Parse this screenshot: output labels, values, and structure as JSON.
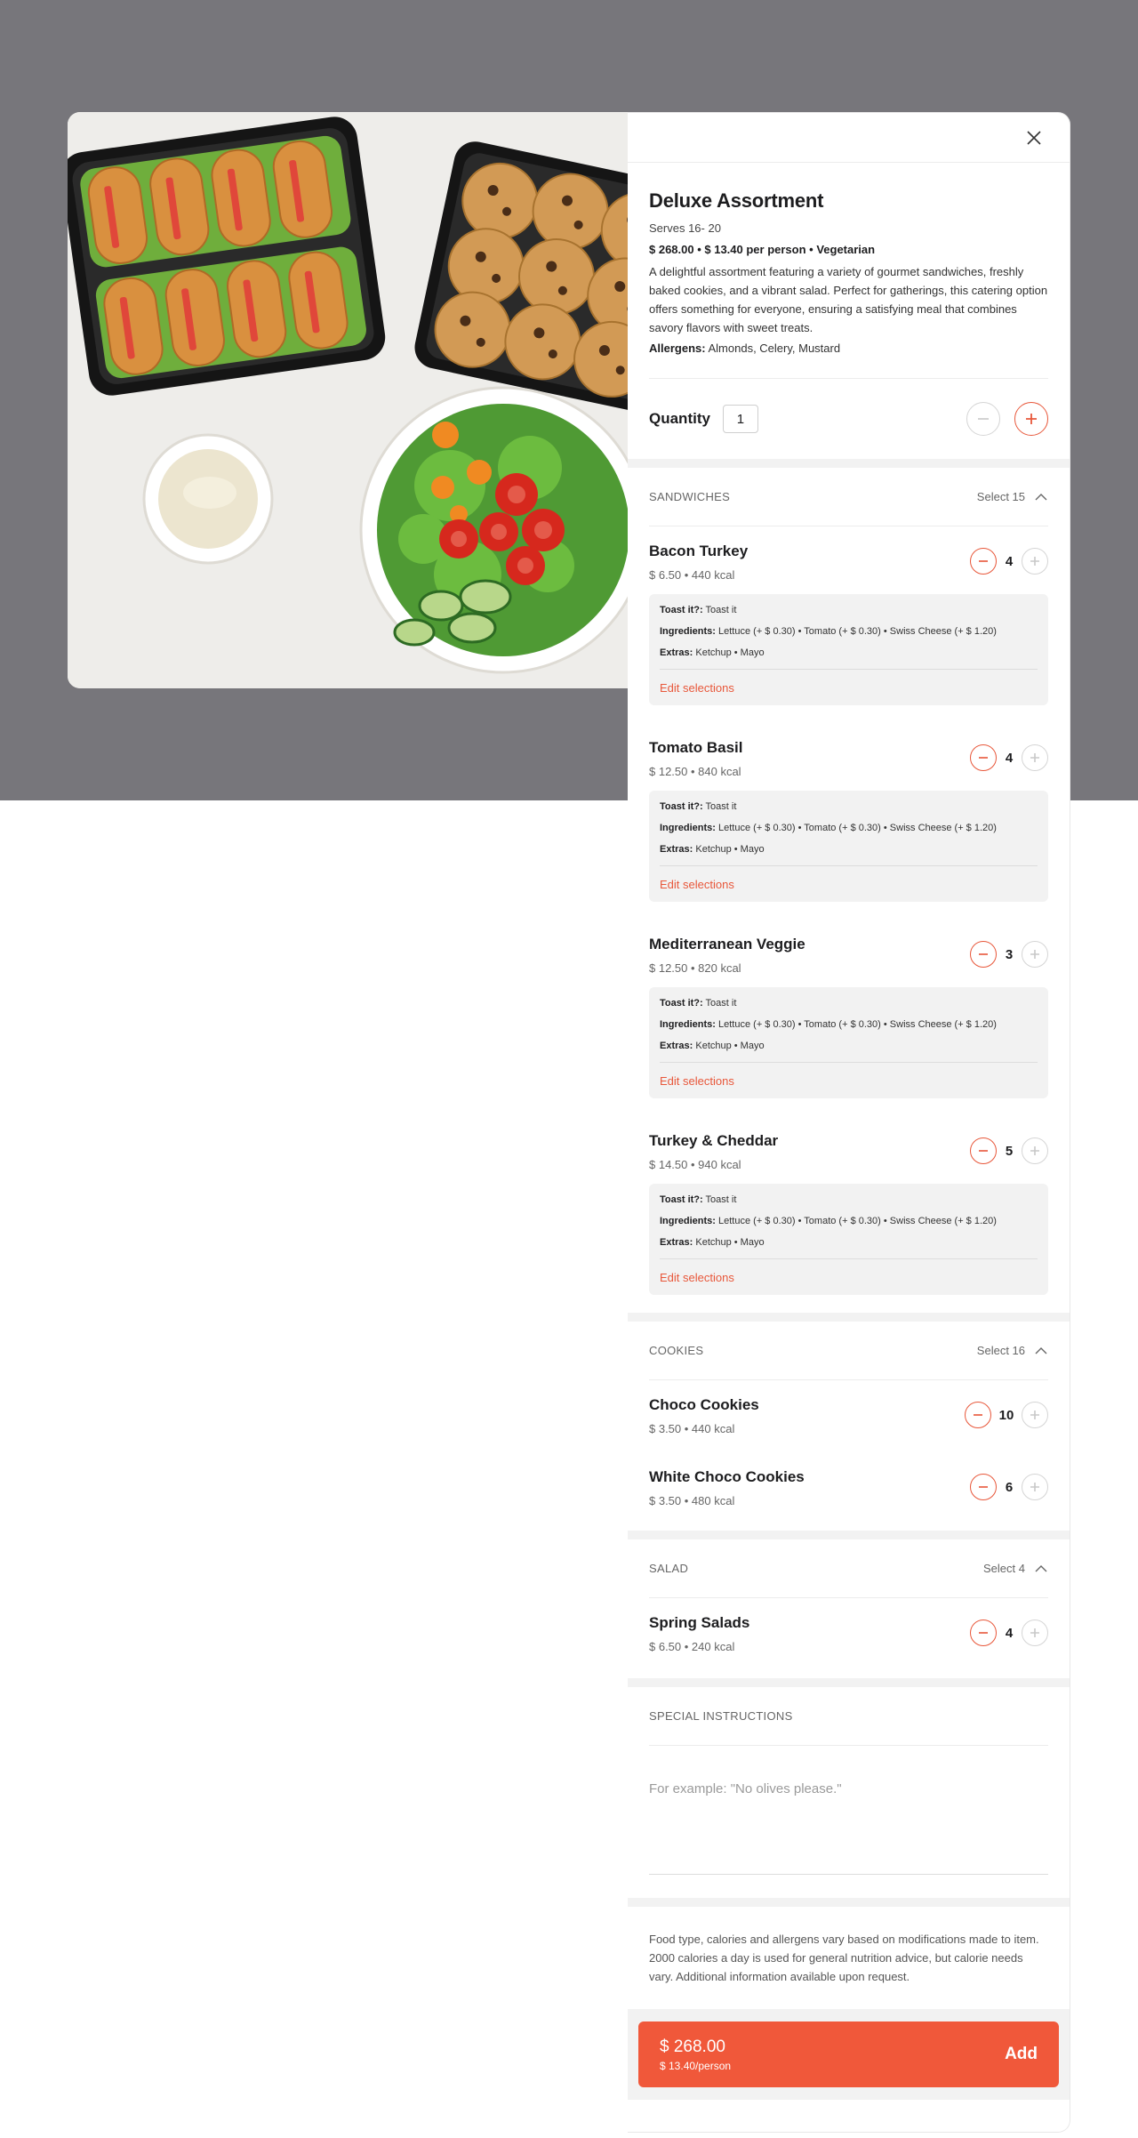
{
  "product": {
    "title": "Deluxe Assortment",
    "serves": "Serves 16- 20",
    "price_line": "$ 268.00 • $ 13.40 per person • Vegetarian",
    "description": "A delightful assortment featuring a variety of gourmet sandwiches, freshly baked cookies, and a vibrant salad. Perfect for gatherings, this catering option offers something for everyone, ensuring a satisfying meal that combines savory flavors with sweet treats.",
    "allergens_label": "Allergens:",
    "allergens_value": "Almonds, Celery, Mustard",
    "image_alt": "Sandwich tray, cookie tray, dip bowl and salad bowl"
  },
  "quantity": {
    "label": "Quantity",
    "value": "1"
  },
  "sections": {
    "sandwiches": {
      "title": "SANDWICHES",
      "select": "Select 15",
      "items": [
        {
          "name": "Bacon Turkey",
          "meta": "$ 6.50 • 440 kcal",
          "count": "4",
          "toast_label": "Toast it?:",
          "toast_value": "Toast it",
          "ingredients_label": "Ingredients:",
          "ingredients_value": "Lettuce (+ $ 0.30) • Tomato (+ $ 0.30) • Swiss Cheese (+ $ 1.20)",
          "extras_label": "Extras:",
          "extras_value": "Ketchup • Mayo",
          "edit": "Edit selections"
        },
        {
          "name": "Tomato Basil",
          "meta": "$ 12.50 • 840 kcal",
          "count": "4",
          "toast_label": "Toast it?:",
          "toast_value": "Toast it",
          "ingredients_label": "Ingredients:",
          "ingredients_value": "Lettuce (+ $ 0.30) • Tomato (+ $ 0.30) • Swiss Cheese (+ $ 1.20)",
          "extras_label": "Extras:",
          "extras_value": "Ketchup • Mayo",
          "edit": "Edit selections"
        },
        {
          "name": "Mediterranean Veggie",
          "meta": "$ 12.50 • 820 kcal",
          "count": "3",
          "toast_label": "Toast it?:",
          "toast_value": "Toast it",
          "ingredients_label": "Ingredients:",
          "ingredients_value": "Lettuce (+ $ 0.30) • Tomato (+ $ 0.30) • Swiss Cheese (+ $ 1.20)",
          "extras_label": "Extras:",
          "extras_value": "Ketchup • Mayo",
          "edit": "Edit selections"
        },
        {
          "name": "Turkey & Cheddar",
          "meta": "$ 14.50 • 940 kcal",
          "count": "5",
          "toast_label": "Toast it?:",
          "toast_value": "Toast it",
          "ingredients_label": "Ingredients:",
          "ingredients_value": "Lettuce (+ $ 0.30) • Tomato (+ $ 0.30) • Swiss Cheese (+ $ 1.20)",
          "extras_label": "Extras:",
          "extras_value": "Ketchup • Mayo",
          "edit": "Edit selections"
        }
      ]
    },
    "cookies": {
      "title": "COOKIES",
      "select": "Select 16",
      "items": [
        {
          "name": "Choco Cookies",
          "meta": "$ 3.50 • 440 kcal",
          "count": "10"
        },
        {
          "name": "White Choco Cookies",
          "meta": "$ 3.50 • 480 kcal",
          "count": "6"
        }
      ]
    },
    "salad": {
      "title": "SALAD",
      "select": "Select 4",
      "items": [
        {
          "name": "Spring Salads",
          "meta": "$ 6.50 • 240 kcal",
          "count": "4"
        }
      ]
    }
  },
  "special": {
    "title": "SPECIAL INSTRUCTIONS",
    "placeholder": "For example: \"No olives please.\""
  },
  "disclaimer": "Food type, calories and allergens vary based on modifications made to item. 2000 calories a day is used for general nutrition advice, but calorie needs vary. Additional information available upon request.",
  "footer": {
    "total": "$ 268.00",
    "per_person": "$ 13.40/person",
    "add_label": "Add"
  },
  "icons": {
    "close": "close-icon",
    "minus": "minus-icon",
    "plus": "plus-icon",
    "chevron": "chevron-up-icon"
  },
  "colors": {
    "accent": "#f0583a",
    "backdrop": "#77767b",
    "panel_bg": "#ffffff",
    "muted_bg": "#f2f2f2"
  }
}
